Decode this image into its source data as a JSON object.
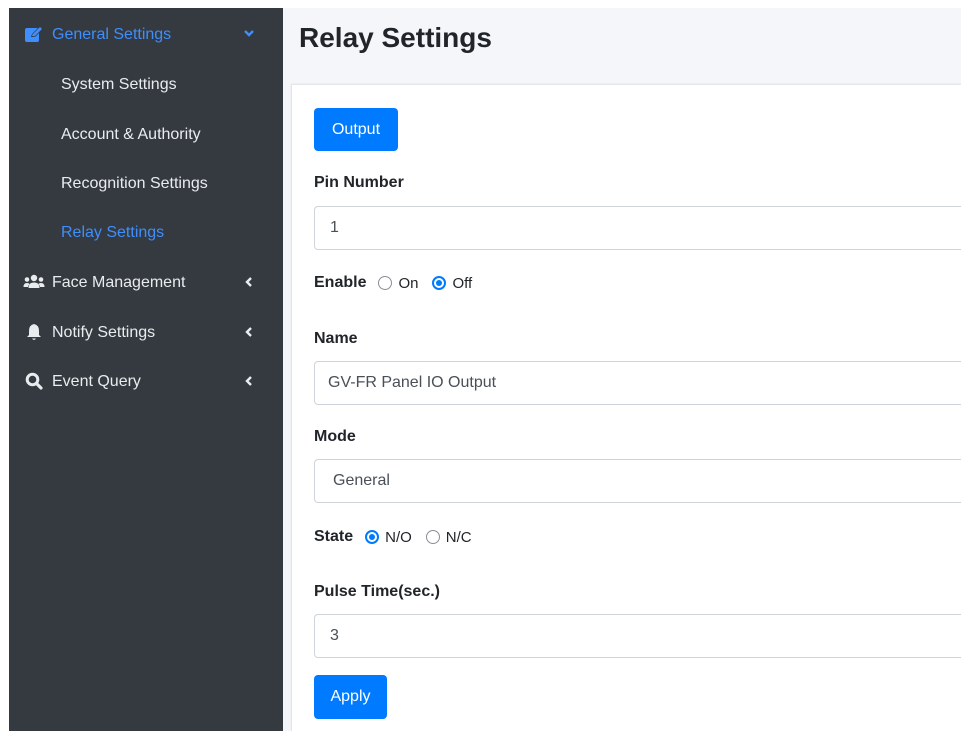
{
  "sidebar": {
    "general_settings": "General Settings",
    "sub_items": [
      "System Settings",
      "Account & Authority",
      "Recognition Settings",
      "Relay Settings"
    ],
    "face_management": "Face Management",
    "notify_settings": "Notify Settings",
    "event_query": "Event Query"
  },
  "page": {
    "title": "Relay Settings"
  },
  "form": {
    "output_button": "Output",
    "pin_number_label": "Pin Number",
    "pin_number_value": "1",
    "enable_label": "Enable",
    "enable_on": "On",
    "enable_off": "Off",
    "enable_selected": "Off",
    "name_label": "Name",
    "name_value": "GV-FR Panel IO Output",
    "mode_label": "Mode",
    "mode_value": "General",
    "state_label": "State",
    "state_no": "N/O",
    "state_nc": "N/C",
    "state_selected": "N/O",
    "pulse_label": "Pulse Time(sec.)",
    "pulse_value": "3",
    "apply_button": "Apply"
  },
  "colors": {
    "accent": "#007bff",
    "sidebar_bg": "#343a40",
    "active_link": "#3f8efc"
  }
}
